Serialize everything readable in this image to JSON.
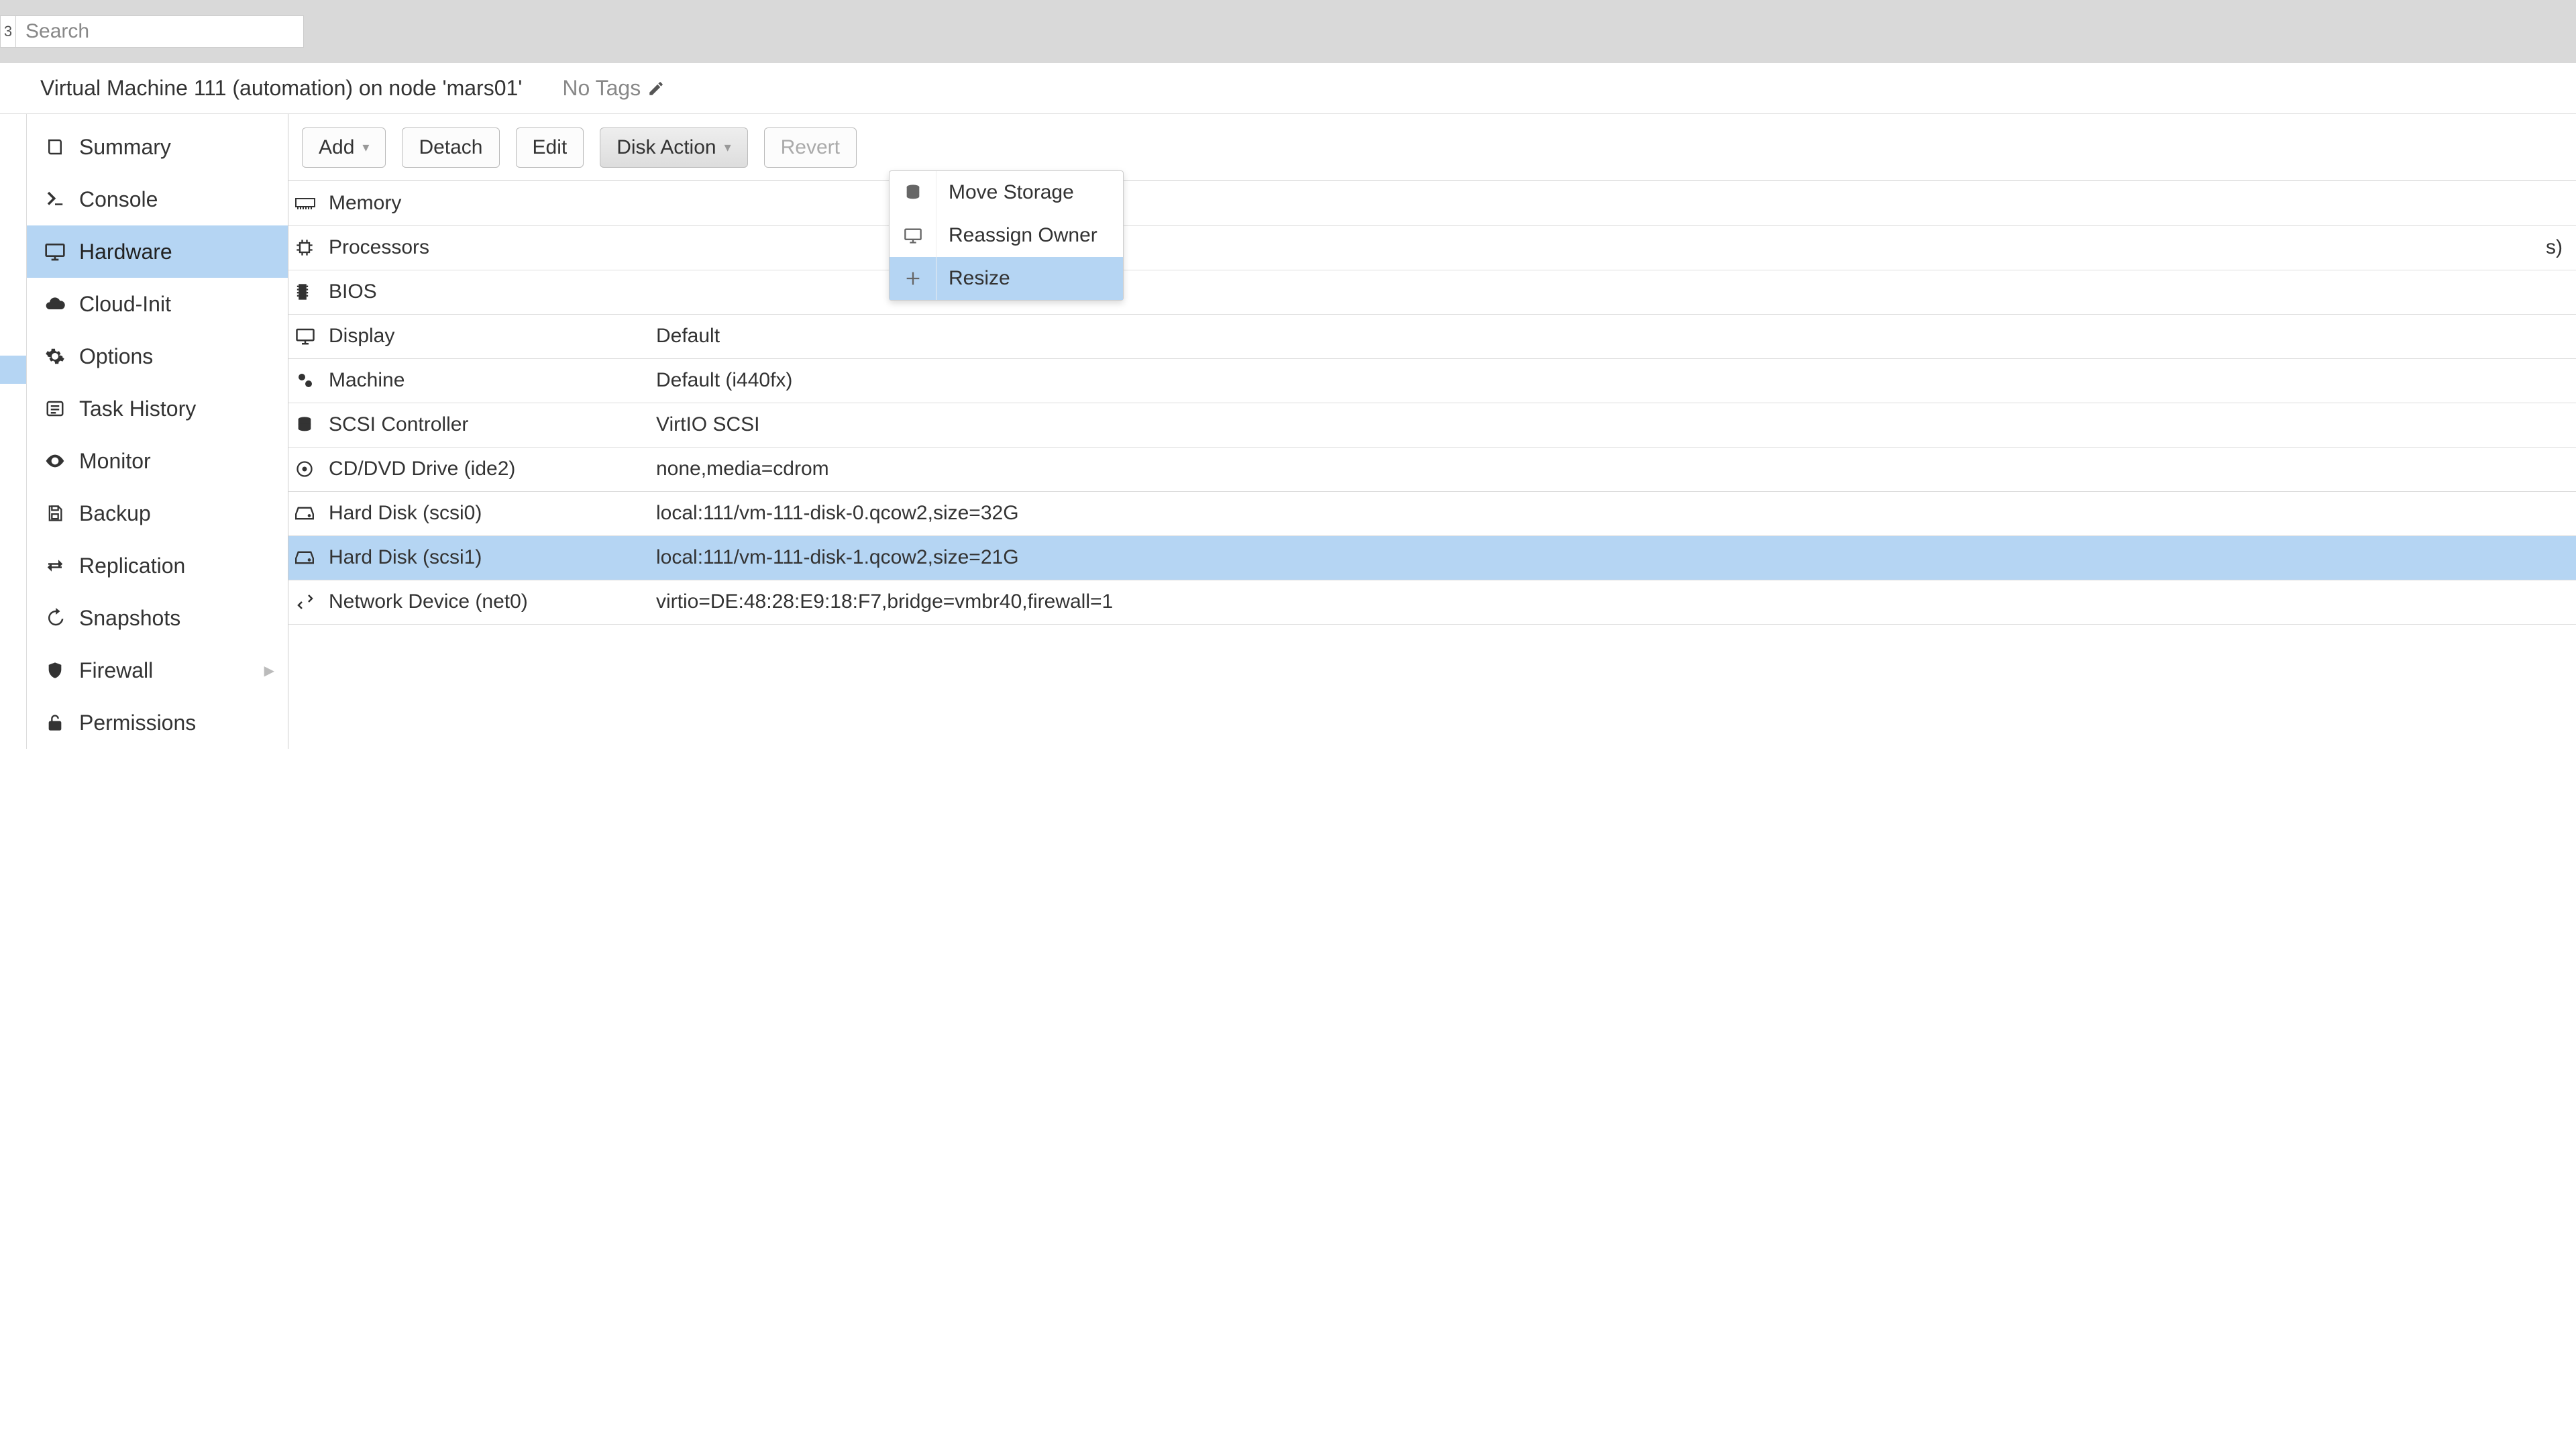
{
  "search": {
    "placeholder": "Search",
    "left_digit": "3"
  },
  "header": {
    "title": "Virtual Machine 111 (automation) on node 'mars01'",
    "tags_label": "No Tags"
  },
  "sidebar": {
    "items": [
      {
        "label": "Summary"
      },
      {
        "label": "Console"
      },
      {
        "label": "Hardware"
      },
      {
        "label": "Cloud-Init"
      },
      {
        "label": "Options"
      },
      {
        "label": "Task History"
      },
      {
        "label": "Monitor"
      },
      {
        "label": "Backup"
      },
      {
        "label": "Replication"
      },
      {
        "label": "Snapshots"
      },
      {
        "label": "Firewall"
      },
      {
        "label": "Permissions"
      }
    ]
  },
  "toolbar": {
    "add": "Add",
    "detach": "Detach",
    "edit": "Edit",
    "disk_action": "Disk Action",
    "revert": "Revert"
  },
  "disk_action_menu": {
    "move_storage": "Move Storage",
    "reassign_owner": "Reassign Owner",
    "resize": "Resize"
  },
  "hardware": {
    "rows": [
      {
        "name": "Memory",
        "value": ""
      },
      {
        "name": "Processors",
        "value": "s)"
      },
      {
        "name": "BIOS",
        "value": ""
      },
      {
        "name": "Display",
        "value": "Default"
      },
      {
        "name": "Machine",
        "value": "Default (i440fx)"
      },
      {
        "name": "SCSI Controller",
        "value": "VirtIO SCSI"
      },
      {
        "name": "CD/DVD Drive (ide2)",
        "value": "none,media=cdrom"
      },
      {
        "name": "Hard Disk (scsi0)",
        "value": "local:111/vm-111-disk-0.qcow2,size=32G"
      },
      {
        "name": "Hard Disk (scsi1)",
        "value": "local:111/vm-111-disk-1.qcow2,size=21G"
      },
      {
        "name": "Network Device (net0)",
        "value": "virtio=DE:48:28:E9:18:F7,bridge=vmbr40,firewall=1"
      }
    ]
  }
}
